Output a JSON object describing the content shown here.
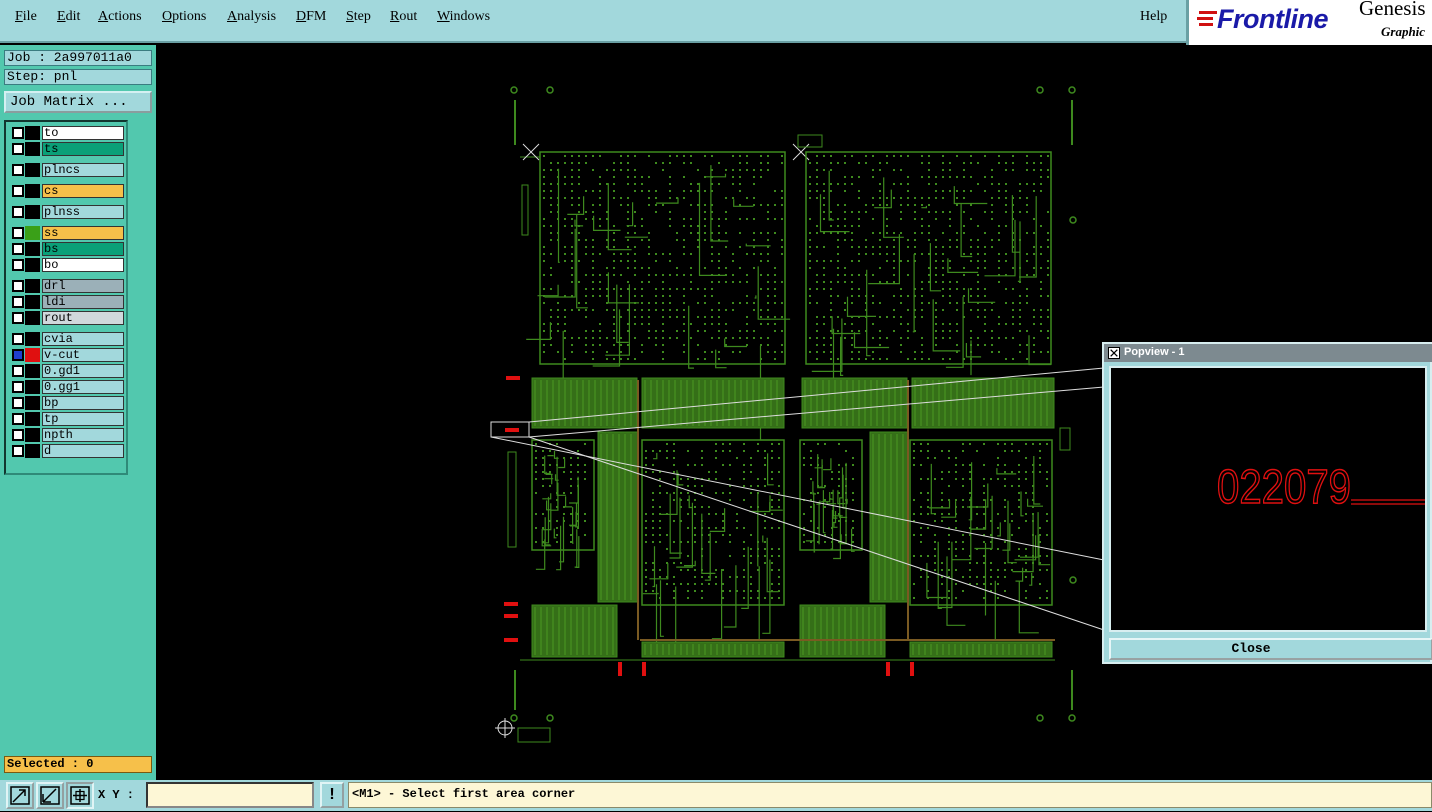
{
  "menu": {
    "items": [
      "File",
      "Edit",
      "Actions",
      "Options",
      "Analysis",
      "DFM",
      "Step",
      "Rout",
      "Windows"
    ],
    "help": "Help"
  },
  "logo": {
    "brand": "Frontline",
    "product": "Genesis",
    "subtitle": "Graphic"
  },
  "job": {
    "job_label": "Job : 2a997011a0",
    "step_label": "Step: pnl",
    "matrix_button": "Job Matrix ..."
  },
  "layers": [
    {
      "name": "to",
      "color": "#ffffff",
      "swatch": "#000000",
      "selected": false
    },
    {
      "name": "ts",
      "color": "#0aa078",
      "swatch": "#000000",
      "selected": false
    },
    {
      "name": "plncs",
      "color": "#a2d8dc",
      "swatch": "#000000",
      "selected": false
    },
    {
      "name": "cs",
      "color": "#f6c04a",
      "swatch": "#000000",
      "selected": false
    },
    {
      "name": "plnss",
      "color": "#a2d8dc",
      "swatch": "#000000",
      "selected": false
    },
    {
      "name": "ss",
      "color": "#f6c04a",
      "swatch": "#3aa018",
      "selected": false
    },
    {
      "name": "bs",
      "color": "#0aa078",
      "swatch": "#000000",
      "selected": false
    },
    {
      "name": "bo",
      "color": "#ffffff",
      "swatch": "#000000",
      "selected": false
    },
    {
      "name": "drl",
      "color": "#9bb0b8",
      "swatch": "#000000",
      "selected": false
    },
    {
      "name": "ldi",
      "color": "#9bb0b8",
      "swatch": "#000000",
      "selected": false
    },
    {
      "name": "rout",
      "color": "#d0d8dc",
      "swatch": "#000000",
      "selected": false
    },
    {
      "name": "cvia",
      "color": "#a2d8dc",
      "swatch": "#000000",
      "selected": false
    },
    {
      "name": "v-cut",
      "color": "#a2d8dc",
      "swatch": "#e01010",
      "selected": true
    },
    {
      "name": "0.gd1",
      "color": "#a2d8dc",
      "swatch": "#000000",
      "selected": false
    },
    {
      "name": "0.gg1",
      "color": "#a2d8dc",
      "swatch": "#000000",
      "selected": false
    },
    {
      "name": "bp",
      "color": "#a2d8dc",
      "swatch": "#000000",
      "selected": false
    },
    {
      "name": "tp",
      "color": "#a2d8dc",
      "swatch": "#000000",
      "selected": false
    },
    {
      "name": "npth",
      "color": "#a2d8dc",
      "swatch": "#000000",
      "selected": false
    },
    {
      "name": "d",
      "color": "#a2d8dc",
      "swatch": "#000000",
      "selected": false
    }
  ],
  "selected_label": "Selected : 0",
  "bottom": {
    "xy_label": "X Y :",
    "xy_value": "",
    "warn": "!",
    "status": "<M1> - Select first area corner"
  },
  "popview": {
    "title": "Popview - 1",
    "close": "Close",
    "zoom_text": "022079"
  },
  "colors": {
    "board_green": "#3e8a1e",
    "vcut_red": "#e01010",
    "panel_teal": "#52c8ae",
    "menu_teal": "#a2d8dc"
  },
  "icons": [
    "zoom-area-icon",
    "zoom-measure-icon",
    "snap-grid-icon",
    "warning-icon",
    "window-close-icon"
  ]
}
